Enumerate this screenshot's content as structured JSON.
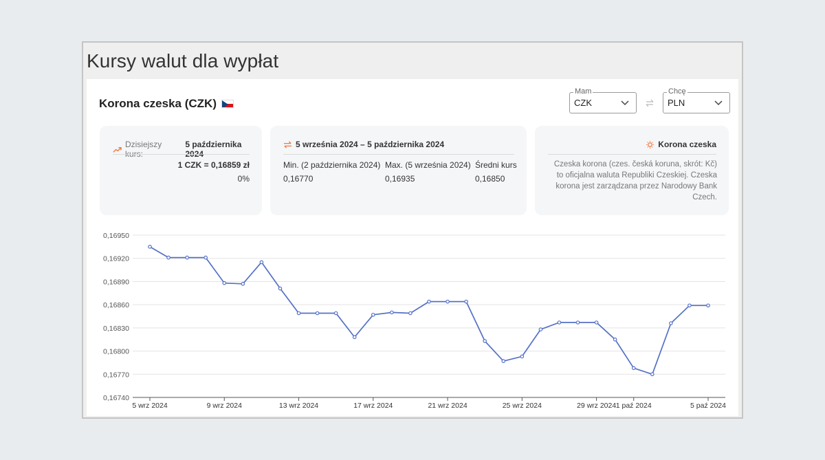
{
  "page_title": "Kursy walut dla wypłat",
  "currency_title": "Korona czeska (CZK)",
  "selectors": {
    "from": {
      "label": "Mam",
      "value": "CZK"
    },
    "to": {
      "label": "Chcę",
      "value": "PLN"
    }
  },
  "today_card": {
    "label": "Dzisiejszy kurs:",
    "date": "5 października 2024",
    "rate": "1 CZK = 0,16859 zł",
    "change": "0%"
  },
  "range_card": {
    "title": "5 września 2024 – 5 października 2024",
    "min_label": "Min. (2 października 2024)",
    "min_value": "0,16770",
    "max_label": "Max. (5 września 2024)",
    "max_value": "0,16935",
    "avg_label": "Średni kurs",
    "avg_value": "0,16850"
  },
  "info_card": {
    "title": "Korona czeska",
    "text": "Czeska korona (czes. česká koruna, skrót: Kč) to oficjalna waluta Republiki Czeskiej. Czeska korona jest zarządzana przez Narodowy Bank Czech."
  },
  "colors": {
    "line": "#5470c6",
    "accent": "#f07a3a"
  },
  "icons": {
    "trend": "trending-up-icon",
    "swap": "swap-arrows-icon",
    "info": "lightbulb-icon"
  },
  "chart_data": {
    "type": "line",
    "x": [
      "5 wrz 2024",
      "6 wrz 2024",
      "7 wrz 2024",
      "8 wrz 2024",
      "9 wrz 2024",
      "10 wrz 2024",
      "11 wrz 2024",
      "12 wrz 2024",
      "13 wrz 2024",
      "14 wrz 2024",
      "15 wrz 2024",
      "16 wrz 2024",
      "17 wrz 2024",
      "18 wrz 2024",
      "19 wrz 2024",
      "20 wrz 2024",
      "21 wrz 2024",
      "22 wrz 2024",
      "23 wrz 2024",
      "24 wrz 2024",
      "25 wrz 2024",
      "26 wrz 2024",
      "27 wrz 2024",
      "28 wrz 2024",
      "29 wrz 2024",
      "30 wrz 2024",
      "1 paź 2024",
      "2 paź 2024",
      "3 paź 2024",
      "4 paź 2024",
      "5 paź 2024"
    ],
    "values": [
      0.16935,
      0.16921,
      0.16921,
      0.16921,
      0.16888,
      0.16887,
      0.16915,
      0.16881,
      0.16849,
      0.16849,
      0.16849,
      0.16818,
      0.16847,
      0.1685,
      0.16849,
      0.16864,
      0.16864,
      0.16864,
      0.16813,
      0.16787,
      0.16793,
      0.16828,
      0.16837,
      0.16837,
      0.16837,
      0.16815,
      0.16778,
      0.1677,
      0.16836,
      0.16859,
      0.16859
    ],
    "x_tick_labels": [
      "5 wrz 2024",
      "9 wrz 2024",
      "13 wrz 2024",
      "17 wrz 2024",
      "21 wrz 2024",
      "25 wrz 2024",
      "29 wrz 2024",
      "1 paź 2024",
      "5 paź 2024"
    ],
    "x_tick_index": [
      0,
      4,
      8,
      12,
      16,
      20,
      24,
      26,
      30
    ],
    "y_tick_labels": [
      "0,16950",
      "0,16920",
      "0,16890",
      "0,16860",
      "0,16830",
      "0,16800",
      "0,16770",
      "0,16740"
    ],
    "y_ticks": [
      0.1695,
      0.1692,
      0.1689,
      0.1686,
      0.1683,
      0.168,
      0.1677,
      0.1674
    ],
    "ylim": [
      0.1674,
      0.1695
    ],
    "grid": true
  }
}
